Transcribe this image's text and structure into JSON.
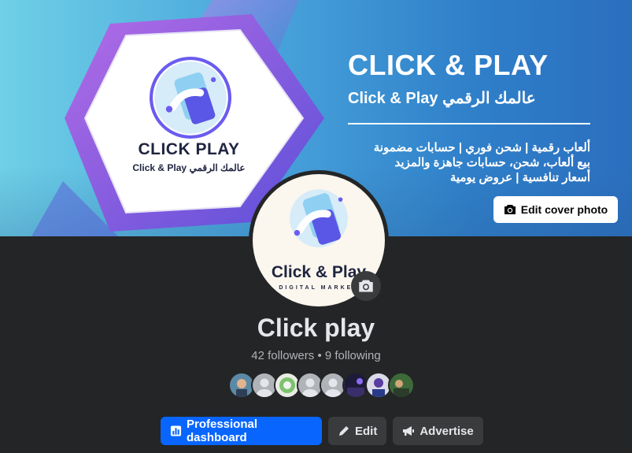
{
  "cover": {
    "brand_title": "CLICK & PLAY",
    "brand_subtitle": "Click & Play عالمك الرقمي",
    "tagline_lines": [
      "ألعاب رقمية | شحن فوري | حسابات مضمونة",
      "بيع ألعاب، شحن، حسابات جاهزة والمزيد",
      "أسعار تنافسية | عروض يومية"
    ],
    "hex_brand": "CLICK PLAY",
    "hex_sub": "Click & Play عالمك الرقمي",
    "edit_cover_label": "Edit cover photo",
    "edit_cover_icon": "camera-icon"
  },
  "profile": {
    "avatar_brand": "Click & Play",
    "avatar_sub": "DIGITAL MARKET",
    "avatar_camera_icon": "camera-icon",
    "name": "Click play",
    "stats": "42 followers • 9 following",
    "follower_avatars": [
      "photo",
      "default",
      "photo",
      "default",
      "default",
      "photo",
      "photo",
      "photo"
    ]
  },
  "actions": {
    "professional_dashboard": "Professional dashboard",
    "edit": "Edit",
    "advertise": "Advertise"
  },
  "colors": {
    "page_bg": "#242526",
    "primary_button": "#0866ff",
    "secondary_button": "#3a3b3c",
    "brand_purple": "#7b5cff"
  }
}
